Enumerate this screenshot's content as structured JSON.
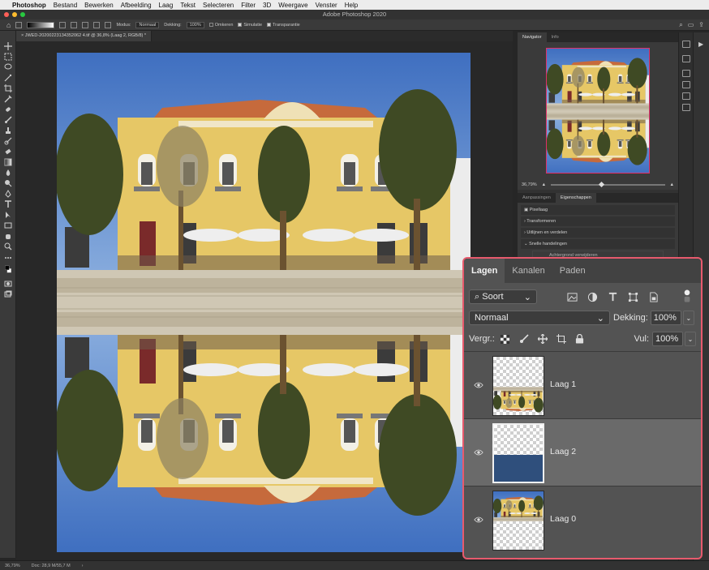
{
  "menubar": {
    "apple": "",
    "items": [
      "Photoshop",
      "Bestand",
      "Bewerken",
      "Afbeelding",
      "Laag",
      "Tekst",
      "Selecteren",
      "Filter",
      "3D",
      "Weergave",
      "Venster",
      "Help"
    ]
  },
  "window": {
    "title": "Adobe Photoshop 2020"
  },
  "options": {
    "modus_label": "Modus:",
    "modus_value": "Normaal",
    "dekking_label": "Dekking:",
    "dekking_value": "100%",
    "omkeren": "Omkeren",
    "simulatie": "Simulatie",
    "transparantie": "Transparantie"
  },
  "document": {
    "tab": "JWED-20200223134352062 4.tif @ 36,8% (Laag 2, RGB/8) *"
  },
  "status": {
    "zoom": "36,79%",
    "doc": "Doc: 28,9 M/55,7 M"
  },
  "navigator": {
    "tab_active": "Navigator",
    "tab_other": "Info",
    "zoom": "36,79%"
  },
  "properties": {
    "tab_other": "Aanpassingen",
    "tab_active": "Eigenschappen",
    "pixel_layer": "Pixellaag",
    "sections": [
      "Transformeren",
      "Uitlijnen en verdelen",
      "Snelle handelingen"
    ],
    "remove_bg": "Achtergrond verwijderen"
  },
  "layers_panel": {
    "tabs": [
      "Lagen",
      "Kanalen",
      "Paden"
    ],
    "filter_label": "Soort",
    "blend_mode": "Normaal",
    "opacity_label": "Dekking:",
    "opacity_value": "100%",
    "lock_label": "Vergr.:",
    "fill_label": "Vul:",
    "fill_value": "100%",
    "layers": [
      {
        "name": "Laag 1",
        "selected": false,
        "thumb": "reflection-top"
      },
      {
        "name": "Laag 2",
        "selected": true,
        "thumb": "blue-bottom"
      },
      {
        "name": "Laag 0",
        "selected": false,
        "thumb": "photo-top"
      }
    ]
  },
  "colors": {
    "highlight_border": "#e75a6d",
    "sky": "#4c79c4",
    "building": "#e6c766",
    "water_fill": "#2f4f7c"
  }
}
